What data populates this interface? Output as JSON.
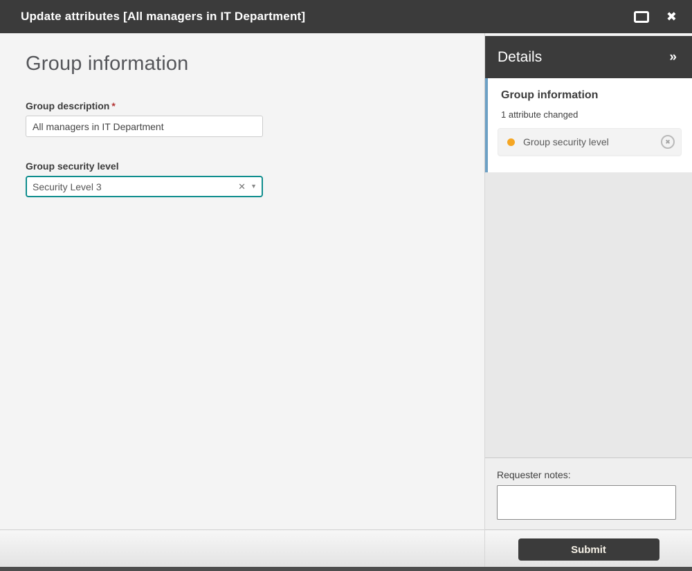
{
  "colors": {
    "titlebar_bg": "#3b3b3b",
    "accent_teal": "#0e8d8d",
    "card_accent_blue": "#6ca0c4",
    "status_orange": "#f5a623",
    "required_red": "#b33434"
  },
  "titlebar": {
    "title": "Update attributes [All managers in IT Department]"
  },
  "main": {
    "heading": "Group information",
    "required_marker": "*",
    "fields": [
      {
        "label": "Group description",
        "required": true,
        "value": "All managers in IT Department"
      },
      {
        "label": "Group security level",
        "required": false,
        "value": "Security Level 3"
      }
    ]
  },
  "details": {
    "title": "Details",
    "section_title": "Group information",
    "changed_summary": "1 attribute changed",
    "changed_attributes": [
      {
        "label": "Group security level"
      }
    ]
  },
  "notes": {
    "label": "Requester notes:",
    "value": ""
  },
  "footer": {
    "submit_label": "Submit"
  },
  "icons": {
    "close": "✖",
    "collapse": "»",
    "clear": "✕",
    "caret": "▼",
    "remove": "✖"
  }
}
